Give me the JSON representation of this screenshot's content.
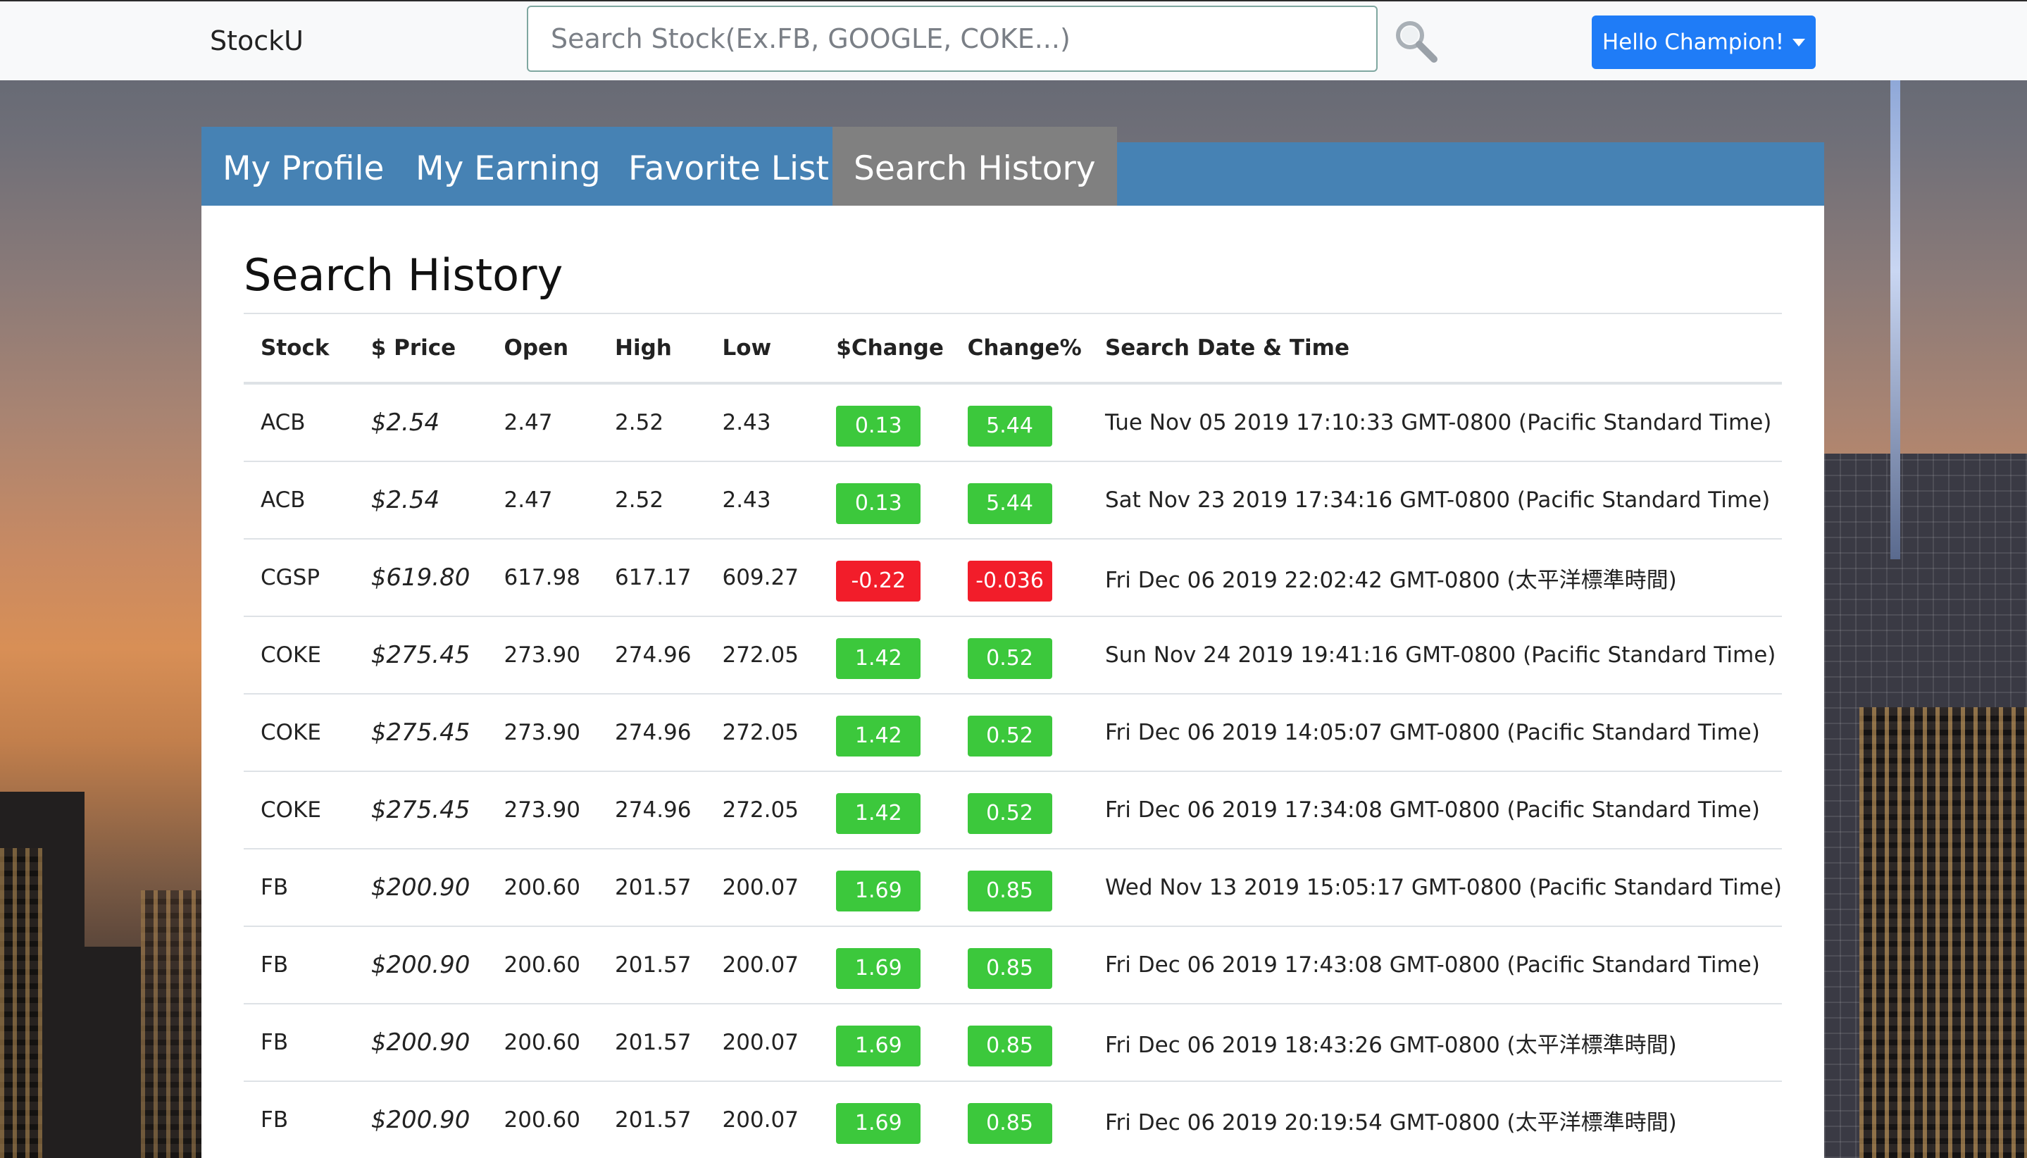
{
  "navbar": {
    "brand": "StockU",
    "search_placeholder": "Search Stock(Ex.FB, GOOGLE, COKE...)",
    "user_button": "Hello Champion!"
  },
  "tabs": [
    {
      "label": "My Profile",
      "active": false
    },
    {
      "label": "My Earning",
      "active": false
    },
    {
      "label": "Favorite List",
      "active": false
    },
    {
      "label": "Search History",
      "active": true
    }
  ],
  "main": {
    "title": "Search History",
    "columns": [
      "Stock",
      "$ Price",
      "Open",
      "High",
      "Low",
      "$Change",
      "Change%",
      "Search Date & Time"
    ],
    "rows": [
      {
        "stock": "ACB",
        "price": "$2.54",
        "open": "2.47",
        "high": "2.52",
        "low": "2.43",
        "change": "0.13",
        "change_pct": "5.44",
        "datetime": "Tue Nov 05 2019 17:10:33 GMT-0800 (Pacific Standard Time)",
        "direction": "up"
      },
      {
        "stock": "ACB",
        "price": "$2.54",
        "open": "2.47",
        "high": "2.52",
        "low": "2.43",
        "change": "0.13",
        "change_pct": "5.44",
        "datetime": "Sat Nov 23 2019 17:34:16 GMT-0800 (Pacific Standard Time)",
        "direction": "up"
      },
      {
        "stock": "CGSP",
        "price": "$619.80",
        "open": "617.98",
        "high": "617.17",
        "low": "609.27",
        "change": "-0.22",
        "change_pct": "-0.036",
        "datetime": "Fri Dec 06 2019 22:02:42 GMT-0800 (太平洋標準時間)",
        "direction": "down"
      },
      {
        "stock": "COKE",
        "price": "$275.45",
        "open": "273.90",
        "high": "274.96",
        "low": "272.05",
        "change": "1.42",
        "change_pct": "0.52",
        "datetime": "Sun Nov 24 2019 19:41:16 GMT-0800 (Pacific Standard Time)",
        "direction": "up"
      },
      {
        "stock": "COKE",
        "price": "$275.45",
        "open": "273.90",
        "high": "274.96",
        "low": "272.05",
        "change": "1.42",
        "change_pct": "0.52",
        "datetime": "Fri Dec 06 2019 14:05:07 GMT-0800 (Pacific Standard Time)",
        "direction": "up"
      },
      {
        "stock": "COKE",
        "price": "$275.45",
        "open": "273.90",
        "high": "274.96",
        "low": "272.05",
        "change": "1.42",
        "change_pct": "0.52",
        "datetime": "Fri Dec 06 2019 17:34:08 GMT-0800 (Pacific Standard Time)",
        "direction": "up"
      },
      {
        "stock": "FB",
        "price": "$200.90",
        "open": "200.60",
        "high": "201.57",
        "low": "200.07",
        "change": "1.69",
        "change_pct": "0.85",
        "datetime": "Wed Nov 13 2019 15:05:17 GMT-0800 (Pacific Standard Time)",
        "direction": "up"
      },
      {
        "stock": "FB",
        "price": "$200.90",
        "open": "200.60",
        "high": "201.57",
        "low": "200.07",
        "change": "1.69",
        "change_pct": "0.85",
        "datetime": "Fri Dec 06 2019 17:43:08 GMT-0800 (Pacific Standard Time)",
        "direction": "up"
      },
      {
        "stock": "FB",
        "price": "$200.90",
        "open": "200.60",
        "high": "201.57",
        "low": "200.07",
        "change": "1.69",
        "change_pct": "0.85",
        "datetime": "Fri Dec 06 2019 18:43:26 GMT-0800 (太平洋標準時間)",
        "direction": "up"
      },
      {
        "stock": "FB",
        "price": "$200.90",
        "open": "200.60",
        "high": "201.57",
        "low": "200.07",
        "change": "1.69",
        "change_pct": "0.85",
        "datetime": "Fri Dec 06 2019 20:19:54 GMT-0800 (太平洋標準時間)",
        "direction": "up"
      }
    ]
  },
  "colors": {
    "navbar_bg": "#f8f9fa",
    "primary_button": "#1f7cf7",
    "tab_bar": "#4682b4",
    "tab_active": "#808080",
    "positive": "#3cc83c",
    "negative": "#f21d2a"
  }
}
